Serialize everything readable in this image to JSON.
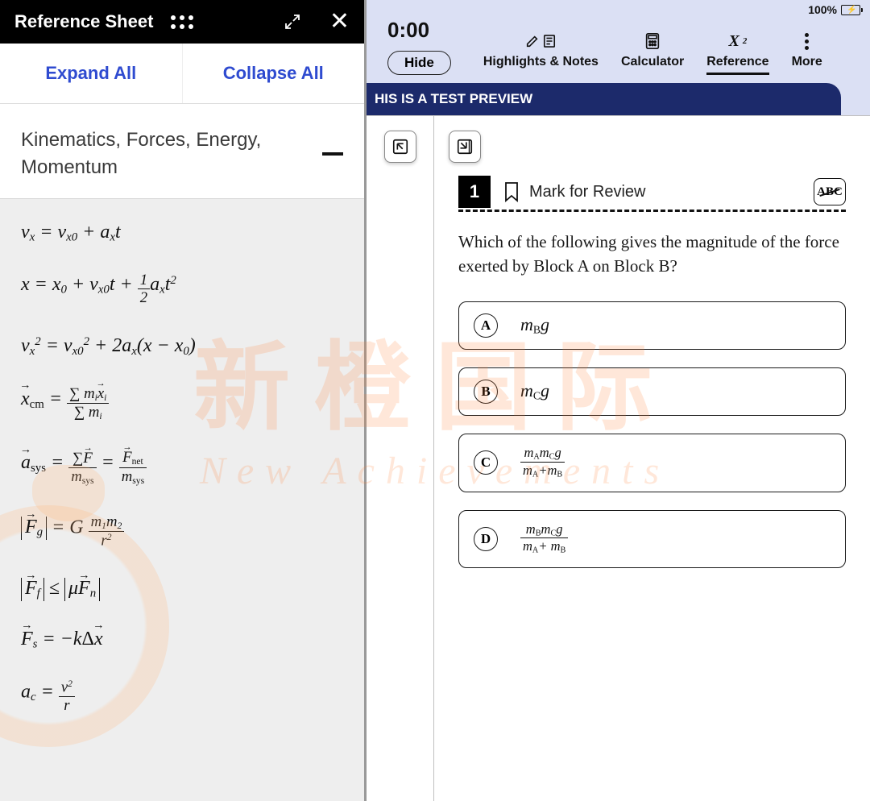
{
  "status": {
    "battery_pct": "100%"
  },
  "reference": {
    "title": "Reference Sheet",
    "expand_all": "Expand All",
    "collapse_all": "Collapse All",
    "section_title": "Kinematics, Forces, Energy, Momentum",
    "formulas_plain": [
      "v_x = v_{x0} + a_x t",
      "x = x_0 + v_{x0} t + (1/2) a_x t^2",
      "v_x^2 = v_{x0}^2 + 2 a_x (x - x_0)",
      "x⃗_cm = (Σ m_i x⃗_i) / (Σ m_i)",
      "a⃗_sys = (Σ F⃗) / m_sys = F⃗_net / m_sys",
      "|F⃗_g| = G m_1 m_2 / r^2",
      "|F⃗_f| ≤ |μ F⃗_n|",
      "F⃗_s = -k Δx⃗",
      "a_c = v^2 / r"
    ]
  },
  "toolbar": {
    "timer": "0:00",
    "hide": "Hide",
    "items": [
      {
        "label": "Highlights & Notes"
      },
      {
        "label": "Calculator"
      },
      {
        "label": "Reference",
        "active": true,
        "icon_text": "X²"
      },
      {
        "label": "More"
      }
    ]
  },
  "preview_banner": "HIS IS A TEST PREVIEW",
  "question": {
    "number": "1",
    "mark_label": "Mark for Review",
    "abc_label": "ABC",
    "text": "Which of the following gives the magnitude of the force exerted by Block A on Block B?",
    "choices": [
      {
        "letter": "A",
        "plain": "m_B g"
      },
      {
        "letter": "B",
        "plain": "m_C g"
      },
      {
        "letter": "C",
        "plain": "(m_A m_C g) / (m_A + m_B)"
      },
      {
        "letter": "D",
        "plain": "(m_B m_C g) / (m_A + m_B)"
      }
    ]
  },
  "watermark": {
    "cn": "新橙国际",
    "en": "New Achievements"
  }
}
